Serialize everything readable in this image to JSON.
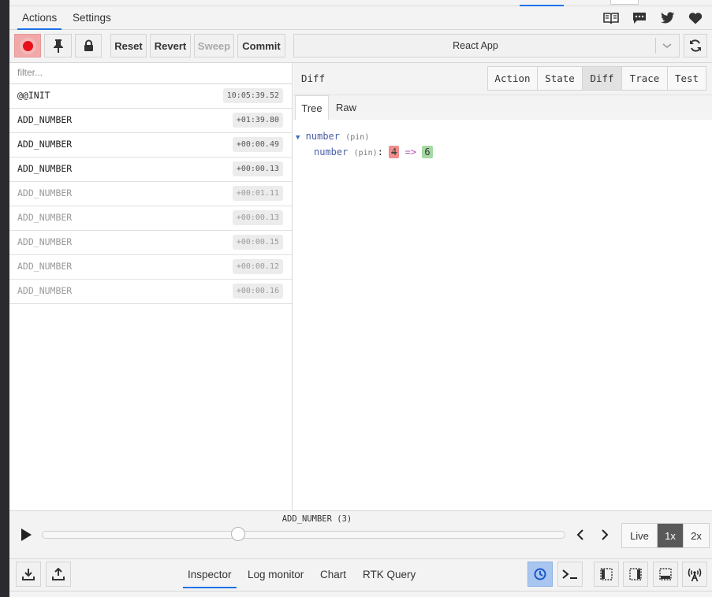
{
  "top_tabs": [
    {
      "label": "Actions"
    },
    {
      "label": "Settings"
    }
  ],
  "toolbar": {
    "reset": "Reset",
    "revert": "Revert",
    "sweep": "Sweep",
    "commit": "Commit",
    "instance": "React App"
  },
  "filter": {
    "placeholder": "filter..."
  },
  "actions": [
    {
      "name": "@@INIT",
      "time": "10:05:39.52",
      "skipped": false
    },
    {
      "name": "ADD_NUMBER",
      "time": "+01:39.80",
      "skipped": false
    },
    {
      "name": "ADD_NUMBER",
      "time": "+00:00.49",
      "skipped": false
    },
    {
      "name": "ADD_NUMBER",
      "time": "+00:00.13",
      "skipped": false
    },
    {
      "name": "ADD_NUMBER",
      "time": "+00:01.11",
      "skipped": true
    },
    {
      "name": "ADD_NUMBER",
      "time": "+00:00.13",
      "skipped": true
    },
    {
      "name": "ADD_NUMBER",
      "time": "+00:00.15",
      "skipped": true
    },
    {
      "name": "ADD_NUMBER",
      "time": "+00:00.12",
      "skipped": true
    },
    {
      "name": "ADD_NUMBER",
      "time": "+00:00.16",
      "skipped": true
    }
  ],
  "inspector": {
    "title": "Diff",
    "tabs": [
      {
        "label": "Action"
      },
      {
        "label": "State"
      },
      {
        "label": "Diff"
      },
      {
        "label": "Trace"
      },
      {
        "label": "Test"
      }
    ],
    "subtabs": [
      {
        "label": "Tree"
      },
      {
        "label": "Raw"
      }
    ],
    "tree": {
      "root_key": "number",
      "root_pin": "(pin)",
      "child_key": "number",
      "child_pin": "(pin)",
      "colon": ":",
      "old_value": "4",
      "arrow": "=>",
      "new_value": "6"
    }
  },
  "slider": {
    "label": "ADD_NUMBER (3)",
    "progress": 0.375
  },
  "speed": {
    "live": "Live",
    "one": "1x",
    "two": "2x"
  },
  "bottom_tabs": [
    {
      "label": "Inspector"
    },
    {
      "label": "Log monitor"
    },
    {
      "label": "Chart"
    },
    {
      "label": "RTK Query"
    }
  ],
  "colors": {
    "accent": "#1a73e8",
    "record": "#e8111a",
    "old_value": "#f08d8d",
    "new_value": "#a4d9a4"
  }
}
